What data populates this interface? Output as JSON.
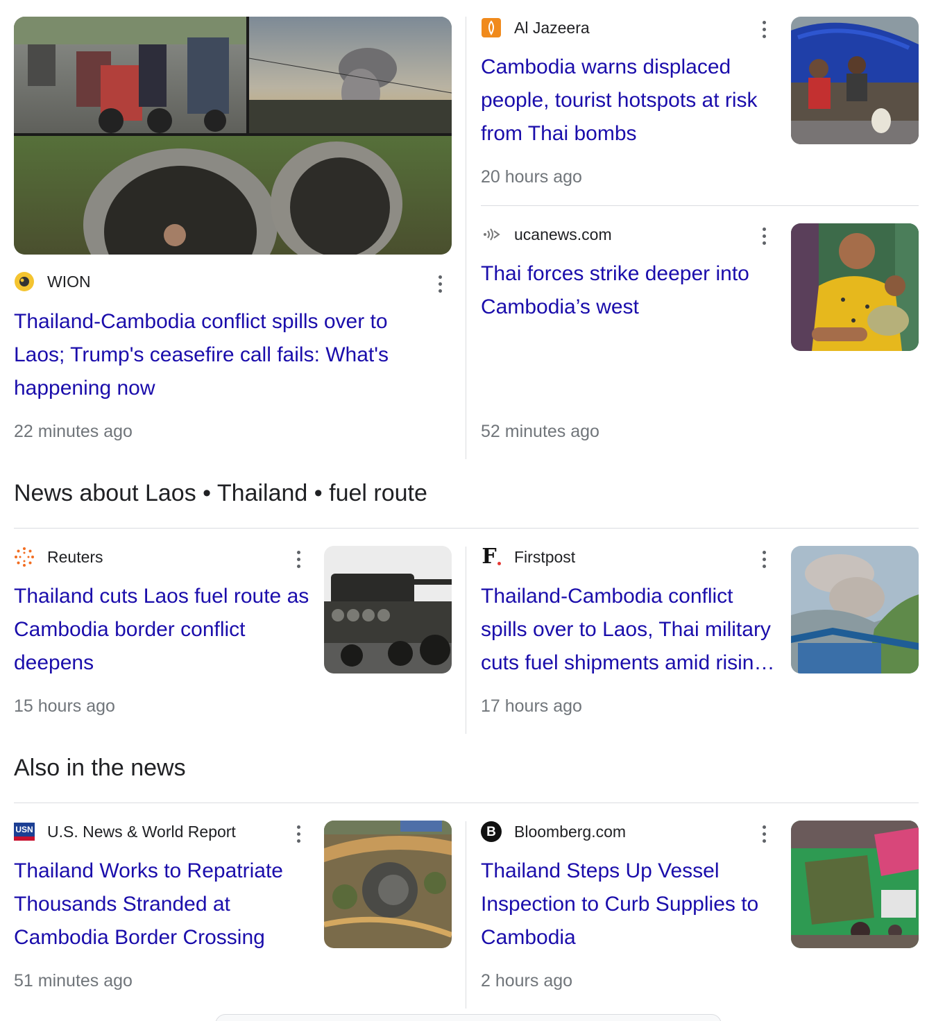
{
  "articles": [
    {
      "source": "WION",
      "source_icon": "wion-logo-icon",
      "title": "Thailand-Cambodia conflict spills over to Laos; Trump's ceasefire call fails: What's happening now",
      "time": "22 minutes ago",
      "image": "collage-traffic-smoke-pipes"
    },
    {
      "source": "Al Jazeera",
      "source_icon": "al-jazeera-logo-icon",
      "title": "Cambodia warns displaced people, tourist hotspots at risk from Thai bombs",
      "time": "20 hours ago",
      "image": "covered-cart-evacuees"
    },
    {
      "source": "ucanews.com",
      "source_icon": "ucanews-logo-icon",
      "title": "Thai forces strike deeper into Cambodia’s west",
      "time": "52 minutes ago",
      "image": "mother-child-shelter"
    }
  ],
  "sections": [
    {
      "heading": "News about Laos • Thailand • fuel route",
      "articles": [
        {
          "source": "Reuters",
          "source_icon": "reuters-logo-icon",
          "title": "Thailand cuts Laos fuel route as Cambodia border conflict deepens",
          "time": "15 hours ago",
          "image": "tank-on-truck"
        },
        {
          "source": "Firstpost",
          "source_icon": "firstpost-logo-icon",
          "title": "Thailand-Cambodia conflict spills over to Laos, Thai military cuts fuel shipments amid rising tensions",
          "time": "17 hours ago",
          "image": "smoke-over-hills"
        }
      ]
    },
    {
      "heading": "Also in the news",
      "articles": [
        {
          "source": "U.S. News & World Report",
          "source_icon": "usn-logo-icon",
          "title": "Thailand Works to Repatriate Thousands Stranded at Cambodia Border Crossing",
          "time": "51 minutes ago",
          "image": "aerial-view"
        },
        {
          "source": "Bloomberg.com",
          "source_icon": "bloomberg-logo-icon",
          "title": "Thailand Steps Up Vessel Inspection to Curb Supplies to Cambodia",
          "time": "2 hours ago",
          "image": "crowded-camp"
        }
      ]
    }
  ],
  "logo_text": {
    "usn": "USN",
    "bloomberg": "B",
    "firstpost": "F"
  },
  "colors": {
    "link": "#1a0dab",
    "meta": "#70757a",
    "divider": "#dadce0",
    "al_jazeera": "#f08a1c",
    "reuters": "#f26d21",
    "usn_red": "#c8102e",
    "usn_blue": "#1c3f94"
  }
}
